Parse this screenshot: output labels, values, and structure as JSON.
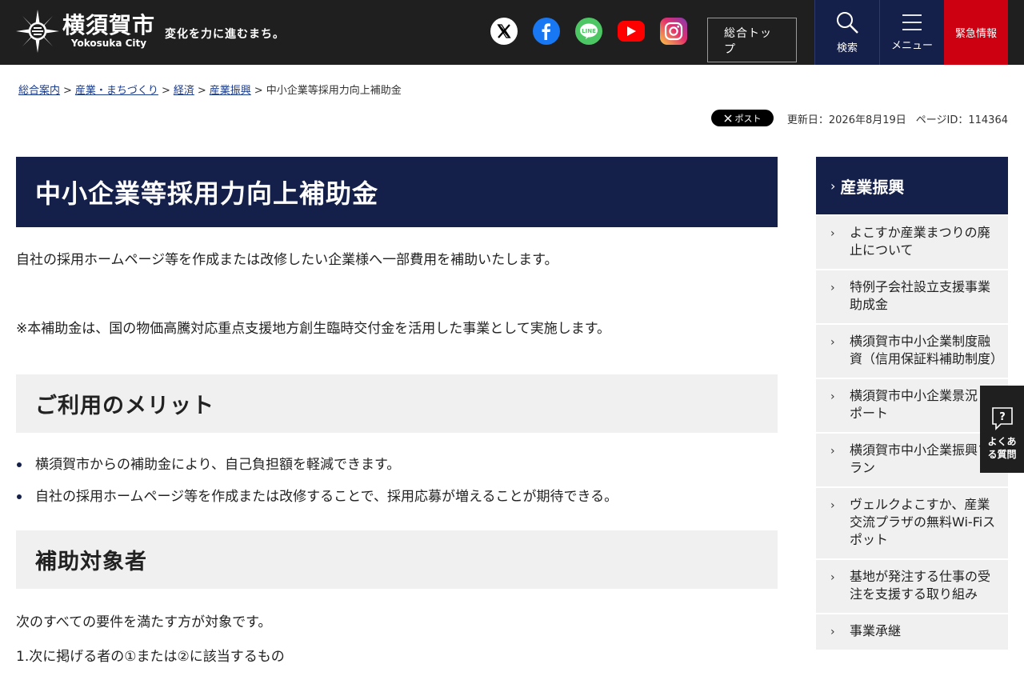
{
  "header": {
    "city_name": "横須賀市",
    "city_name_en": "Yokosuka City",
    "tagline": "変化を力に進むまち。",
    "social": [
      "x-icon",
      "facebook-icon",
      "line-icon",
      "youtube-icon",
      "instagram-icon"
    ],
    "top_button": "総合トップ",
    "search_label": "検索",
    "menu_label": "メニュー",
    "emergency_label": "緊急情報",
    "colors": {
      "header_bg": "#1f1f1f",
      "navy": "#15204a",
      "emergency": "#cc0011"
    }
  },
  "breadcrumb": {
    "items": [
      "総合案内",
      "産業・まちづくり",
      "経済",
      "産業振興"
    ],
    "current": "中小企業等採用力向上補助金",
    "separator": ">"
  },
  "meta": {
    "post_label": "ポスト",
    "updated": "更新日：2026年8月19日",
    "page_id": "ページID：114364"
  },
  "main": {
    "title": "中小企業等採用力向上補助金",
    "intro": "自社の採用ホームページ等を作成または改修したい企業様へ一部費用を補助いたします。",
    "note": "※本補助金は、国の物価高騰対応重点支援地方創生臨時交付金を活用した事業として実施します。",
    "section1": {
      "heading": "ご利用のメリット",
      "bullets": [
        "横須賀市からの補助金により、自己負担額を軽減できます。",
        "自社の採用ホームページ等を作成または改修することで、採用応募が増えることが期待できる。"
      ]
    },
    "section2": {
      "heading": "補助対象者",
      "text": "次のすべての要件を満たす方が対象です。",
      "item1": "1.次に掲げる者の①または②に該当するもの"
    }
  },
  "sidebar": {
    "heading": "産業振興",
    "items": [
      "よこすか産業まつりの廃止について",
      "特例子会社設立支援事業助成金",
      "横須賀市中小企業制度融資（信用保証料補助制度）",
      "横須賀市中小企業景況レポート",
      "横須賀市中小企業振興プラン",
      "ヴェルクよこすか、産業交流プラザの無料Wi-Fiスポット",
      "基地が発注する仕事の受注を支援する取り組み",
      "事業承継"
    ]
  },
  "faq": {
    "label": "よくある質問"
  }
}
